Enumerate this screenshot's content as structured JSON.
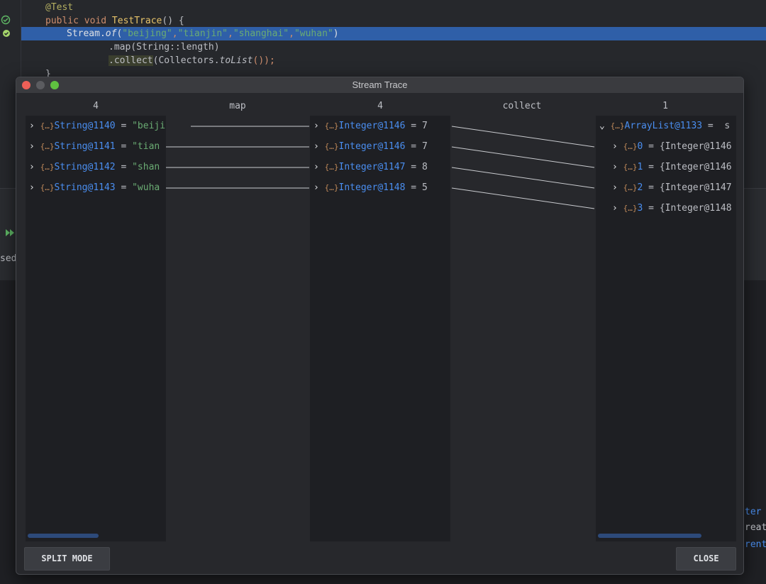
{
  "editor": {
    "lines": [
      {
        "annotation": "@Test"
      },
      {
        "kw": "public void ",
        "fn": "TestTrace",
        "rest": "() {"
      },
      {
        "a": "Stream.",
        "b": "of",
        "c": "(",
        "s1": "\"beijing\"",
        "s2": "\"tianjin\"",
        "s3": "\"shanghai\"",
        "s4": "\"wuhan\"",
        "d": ")"
      },
      {
        "text": ".map(String::length)"
      },
      {
        "a": ".collect",
        "b": "(Collectors.",
        "c": "toList",
        "d": "());"
      },
      {
        "text": "}"
      }
    ],
    "background_fragments": [
      "sed",
      "ter",
      "reat",
      "rent"
    ]
  },
  "dialog": {
    "title": "Stream Trace",
    "headers": [
      "4",
      "map",
      "4",
      "collect",
      "1"
    ],
    "source": [
      {
        "name": "String@1140",
        "value": "\"beijing\""
      },
      {
        "name": "String@1141",
        "value": "\"tian"
      },
      {
        "name": "String@1142",
        "value": "\"shan"
      },
      {
        "name": "String@1143",
        "value": "\"wuha"
      }
    ],
    "mapped": [
      {
        "name": "Integer@1146",
        "value": "7"
      },
      {
        "name": "Integer@1146",
        "value": "7"
      },
      {
        "name": "Integer@1147",
        "value": "8"
      },
      {
        "name": "Integer@1148",
        "value": "5"
      }
    ],
    "result": {
      "name": "ArrayList@1133",
      "value": "s",
      "items": [
        {
          "index": "0",
          "value": "{Integer@1146"
        },
        {
          "index": "1",
          "value": "{Integer@1146"
        },
        {
          "index": "2",
          "value": "{Integer@1147"
        },
        {
          "index": "3",
          "value": "{Integer@1148"
        }
      ]
    },
    "split_mode_label": "SPLIT MODE",
    "close_label": "CLOSE"
  },
  "colors": {
    "accent": "#4a8ef0",
    "highlight": "#2f5fa8",
    "string": "#6aab73"
  }
}
